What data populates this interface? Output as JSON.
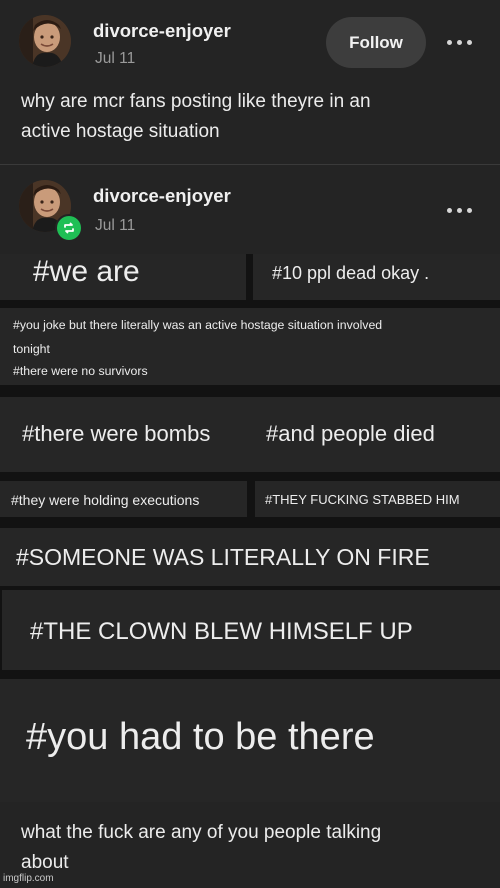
{
  "post1": {
    "username": "divorce-enjoyer",
    "date": "Jul 11",
    "follow_label": "Follow",
    "text_line1": "why are mcr fans posting like theyre in an",
    "text_line2": "active hostage situation"
  },
  "post2": {
    "username": "divorce-enjoyer",
    "date": "Jul 11"
  },
  "tags": {
    "we_are": "#we are",
    "ten_ppl": "#10 ppl dead okay .",
    "joke_line1": "#you joke but there literally was an active hostage situation involved",
    "joke_line2": "tonight",
    "no_survivors": "#there were no survivors",
    "bombs": "#there were bombs",
    "people_died": "#and people died",
    "executions": "#they were holding executions",
    "stabbed": "#THEY FUCKING STABBED HIM",
    "fire": "#SOMEONE WAS LITERALLY ON FIRE",
    "clown": "#THE CLOWN BLEW HIMSELF UP",
    "there": "#you had to be there"
  },
  "reply": {
    "line1": "what the fuck are any of you people talking",
    "line2": "about"
  },
  "watermark": "imgflip.com",
  "colors": {
    "background": "#242424",
    "reblog_green": "#1fbf55",
    "follow_button": "#3d3d3d"
  }
}
